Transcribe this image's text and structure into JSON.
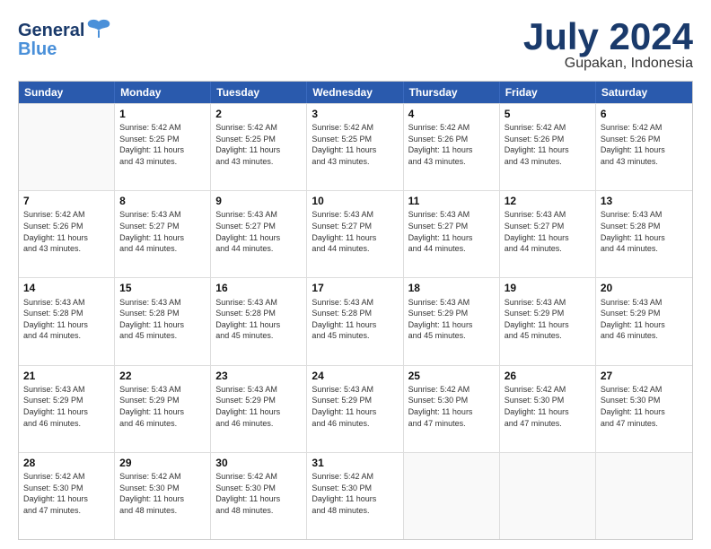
{
  "logo": {
    "line1": "General",
    "line2": "Blue"
  },
  "title": "July 2024",
  "subtitle": "Gupakan, Indonesia",
  "header_days": [
    "Sunday",
    "Monday",
    "Tuesday",
    "Wednesday",
    "Thursday",
    "Friday",
    "Saturday"
  ],
  "weeks": [
    [
      {
        "day": "",
        "info": ""
      },
      {
        "day": "1",
        "info": "Sunrise: 5:42 AM\nSunset: 5:25 PM\nDaylight: 11 hours\nand 43 minutes."
      },
      {
        "day": "2",
        "info": "Sunrise: 5:42 AM\nSunset: 5:25 PM\nDaylight: 11 hours\nand 43 minutes."
      },
      {
        "day": "3",
        "info": "Sunrise: 5:42 AM\nSunset: 5:25 PM\nDaylight: 11 hours\nand 43 minutes."
      },
      {
        "day": "4",
        "info": "Sunrise: 5:42 AM\nSunset: 5:26 PM\nDaylight: 11 hours\nand 43 minutes."
      },
      {
        "day": "5",
        "info": "Sunrise: 5:42 AM\nSunset: 5:26 PM\nDaylight: 11 hours\nand 43 minutes."
      },
      {
        "day": "6",
        "info": "Sunrise: 5:42 AM\nSunset: 5:26 PM\nDaylight: 11 hours\nand 43 minutes."
      }
    ],
    [
      {
        "day": "7",
        "info": "Sunrise: 5:42 AM\nSunset: 5:26 PM\nDaylight: 11 hours\nand 43 minutes."
      },
      {
        "day": "8",
        "info": "Sunrise: 5:43 AM\nSunset: 5:27 PM\nDaylight: 11 hours\nand 44 minutes."
      },
      {
        "day": "9",
        "info": "Sunrise: 5:43 AM\nSunset: 5:27 PM\nDaylight: 11 hours\nand 44 minutes."
      },
      {
        "day": "10",
        "info": "Sunrise: 5:43 AM\nSunset: 5:27 PM\nDaylight: 11 hours\nand 44 minutes."
      },
      {
        "day": "11",
        "info": "Sunrise: 5:43 AM\nSunset: 5:27 PM\nDaylight: 11 hours\nand 44 minutes."
      },
      {
        "day": "12",
        "info": "Sunrise: 5:43 AM\nSunset: 5:27 PM\nDaylight: 11 hours\nand 44 minutes."
      },
      {
        "day": "13",
        "info": "Sunrise: 5:43 AM\nSunset: 5:28 PM\nDaylight: 11 hours\nand 44 minutes."
      }
    ],
    [
      {
        "day": "14",
        "info": "Sunrise: 5:43 AM\nSunset: 5:28 PM\nDaylight: 11 hours\nand 44 minutes."
      },
      {
        "day": "15",
        "info": "Sunrise: 5:43 AM\nSunset: 5:28 PM\nDaylight: 11 hours\nand 45 minutes."
      },
      {
        "day": "16",
        "info": "Sunrise: 5:43 AM\nSunset: 5:28 PM\nDaylight: 11 hours\nand 45 minutes."
      },
      {
        "day": "17",
        "info": "Sunrise: 5:43 AM\nSunset: 5:28 PM\nDaylight: 11 hours\nand 45 minutes."
      },
      {
        "day": "18",
        "info": "Sunrise: 5:43 AM\nSunset: 5:29 PM\nDaylight: 11 hours\nand 45 minutes."
      },
      {
        "day": "19",
        "info": "Sunrise: 5:43 AM\nSunset: 5:29 PM\nDaylight: 11 hours\nand 45 minutes."
      },
      {
        "day": "20",
        "info": "Sunrise: 5:43 AM\nSunset: 5:29 PM\nDaylight: 11 hours\nand 46 minutes."
      }
    ],
    [
      {
        "day": "21",
        "info": "Sunrise: 5:43 AM\nSunset: 5:29 PM\nDaylight: 11 hours\nand 46 minutes."
      },
      {
        "day": "22",
        "info": "Sunrise: 5:43 AM\nSunset: 5:29 PM\nDaylight: 11 hours\nand 46 minutes."
      },
      {
        "day": "23",
        "info": "Sunrise: 5:43 AM\nSunset: 5:29 PM\nDaylight: 11 hours\nand 46 minutes."
      },
      {
        "day": "24",
        "info": "Sunrise: 5:43 AM\nSunset: 5:29 PM\nDaylight: 11 hours\nand 46 minutes."
      },
      {
        "day": "25",
        "info": "Sunrise: 5:42 AM\nSunset: 5:30 PM\nDaylight: 11 hours\nand 47 minutes."
      },
      {
        "day": "26",
        "info": "Sunrise: 5:42 AM\nSunset: 5:30 PM\nDaylight: 11 hours\nand 47 minutes."
      },
      {
        "day": "27",
        "info": "Sunrise: 5:42 AM\nSunset: 5:30 PM\nDaylight: 11 hours\nand 47 minutes."
      }
    ],
    [
      {
        "day": "28",
        "info": "Sunrise: 5:42 AM\nSunset: 5:30 PM\nDaylight: 11 hours\nand 47 minutes."
      },
      {
        "day": "29",
        "info": "Sunrise: 5:42 AM\nSunset: 5:30 PM\nDaylight: 11 hours\nand 48 minutes."
      },
      {
        "day": "30",
        "info": "Sunrise: 5:42 AM\nSunset: 5:30 PM\nDaylight: 11 hours\nand 48 minutes."
      },
      {
        "day": "31",
        "info": "Sunrise: 5:42 AM\nSunset: 5:30 PM\nDaylight: 11 hours\nand 48 minutes."
      },
      {
        "day": "",
        "info": ""
      },
      {
        "day": "",
        "info": ""
      },
      {
        "day": "",
        "info": ""
      }
    ]
  ]
}
